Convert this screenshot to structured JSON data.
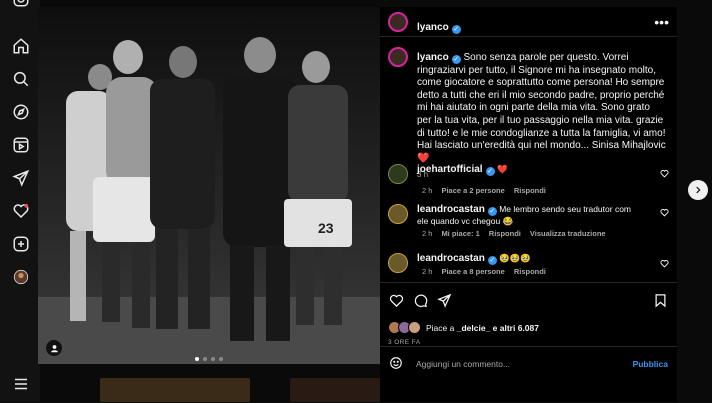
{
  "post": {
    "username": "lyanco",
    "caption": "Sono senza parole per questo. Vorrei ringraziarvi per tutto, il Signore mi ha insegnato molto, come giocatore e soprattutto come persona! Ho sempre detto a tutti che eri il mio secondo padre, proprio perché mi hai aiutato in ogni parte della mia vita. Sono grato per la tua vita, per il tuo passaggio nella mia vita. grazie di tutto! e le mie condoglianze a tutta la famiglia, vi amo! Hai lasciato un'eredità qui nel mondo... Sinisa Mihajlovic ❤️",
    "caption_time": "3 h",
    "likes_prefix": "Piace a",
    "likes_user": "_delcie_",
    "likes_suffix": "e altri 6.087",
    "date": "3 ORE FA",
    "image_page": 0,
    "image_count": 4
  },
  "comments": [
    {
      "user": "joehartofficial",
      "verified": true,
      "text": "❤️",
      "time": "2 h",
      "likes": "Piace a 2 persone",
      "reply": "Rispondi",
      "translation": ""
    },
    {
      "user": "leandrocastan",
      "verified": true,
      "text": "Me lembro sendo seu tradutor com ele quando vc chegou 😂",
      "time": "2 h",
      "likes": "Mi piace: 1",
      "reply": "Rispondi",
      "translation": "Visualizza traduzione"
    },
    {
      "user": "leandrocastan",
      "verified": true,
      "text": "🥹🥹🥹",
      "time": "2 h",
      "likes": "Piace a 8 persone",
      "reply": "Rispondi",
      "translation": ""
    }
  ],
  "add_comment": {
    "placeholder": "Aggiungi un commento...",
    "publish": "Pubblica"
  },
  "colors": {
    "accent": "#3897f0",
    "like_red": "#ed4956",
    "panel_bg": "#000000",
    "muted": "#a8a8a8"
  },
  "icons": {
    "nav": [
      "instagram-icon",
      "home-icon",
      "search-icon",
      "explore-icon",
      "reels-icon",
      "direct-icon",
      "notifications-icon",
      "create-icon",
      "profile-icon",
      "menu-icon"
    ],
    "actions": [
      "like-icon",
      "comment-icon",
      "share-icon",
      "save-icon"
    ]
  }
}
